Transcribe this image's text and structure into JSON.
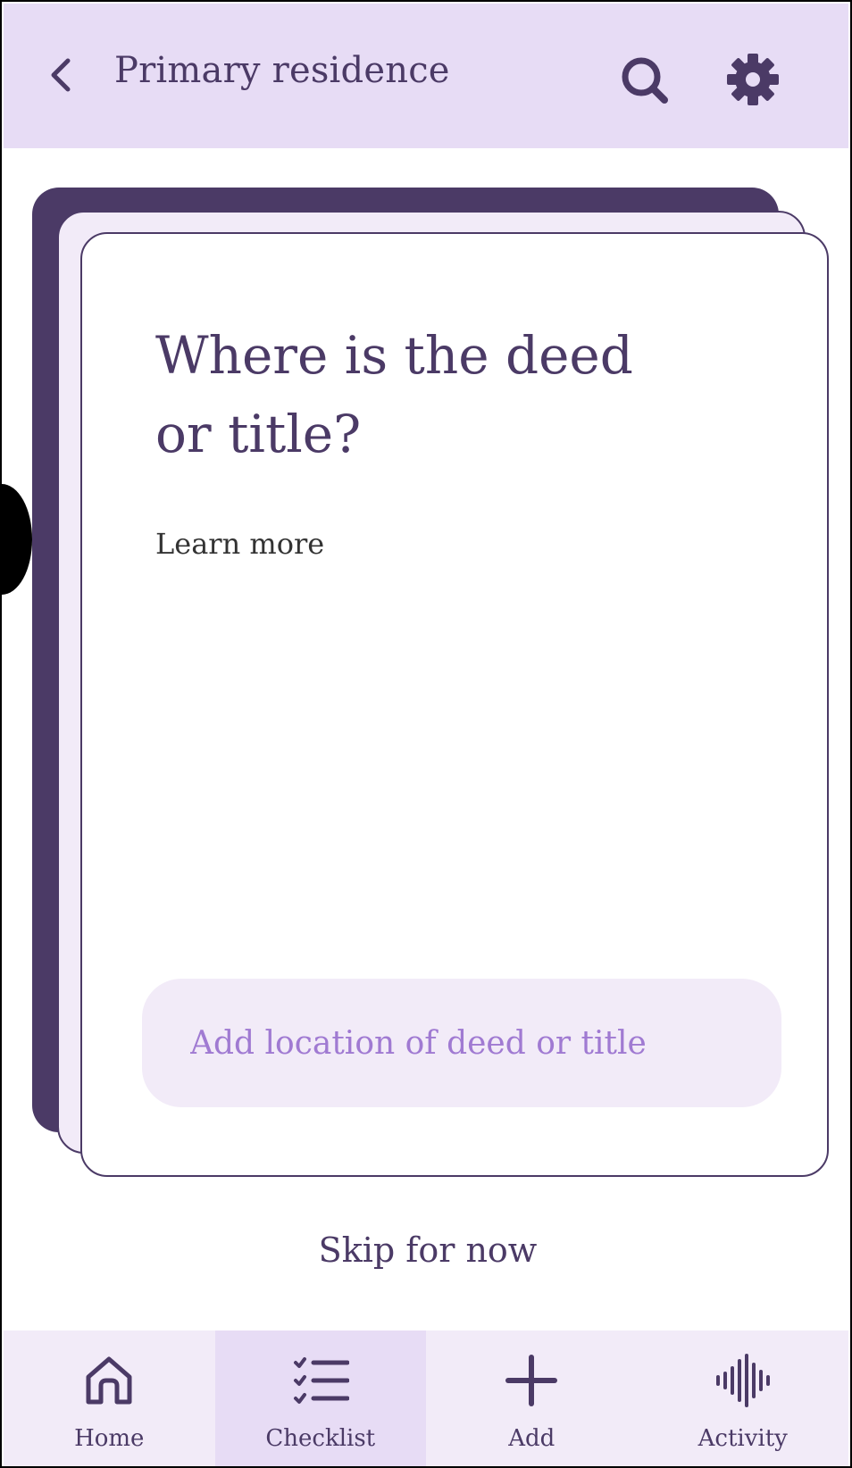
{
  "header": {
    "title": "Primary residence",
    "back_icon": "chevron-left-icon",
    "search_icon": "search-icon",
    "settings_icon": "gear-icon",
    "background": "#e7dcf5"
  },
  "card": {
    "question": "Where is the deed or title?",
    "learn_more": "Learn more",
    "input_placeholder": "Add location of deed or title",
    "input_value": ""
  },
  "skip_label": "Skip for now",
  "nav": {
    "items": [
      {
        "label": "Home",
        "icon": "home-icon",
        "active": false
      },
      {
        "label": "Checklist",
        "icon": "checklist-icon",
        "active": true
      },
      {
        "label": "Add",
        "icon": "plus-icon",
        "active": false
      },
      {
        "label": "Activity",
        "icon": "waveform-icon",
        "active": false
      }
    ]
  },
  "colors": {
    "primary": "#4b3a66",
    "header_bg": "#e7dcf5",
    "light_bg": "#f2ebf8",
    "placeholder": "#a07ad2"
  }
}
